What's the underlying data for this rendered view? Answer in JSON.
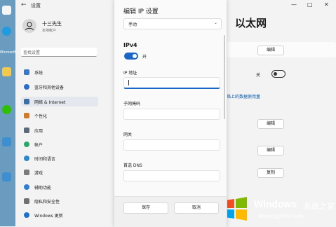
{
  "app": {
    "title": "设置"
  },
  "window_buttons": {
    "minimize": "—",
    "maximize": "□",
    "close": "✕"
  },
  "user": {
    "name": "十三先生",
    "subtitle": "本地帐户"
  },
  "search": {
    "placeholder": "查找设置"
  },
  "sidebar": {
    "items": [
      {
        "label": "系统",
        "color": "#3b78c4"
      },
      {
        "label": "蓝牙和其他设备",
        "color": "#2b6cc4"
      },
      {
        "label": "网络 & Internet",
        "color": "#3a6ea5"
      },
      {
        "label": "个性化",
        "color": "#d07b2a"
      },
      {
        "label": "应用",
        "color": "#5b6a7a"
      },
      {
        "label": "帐户",
        "color": "#2aa86a"
      },
      {
        "label": "时间和语言",
        "color": "#2c89c9"
      },
      {
        "label": "游戏",
        "color": "#7a7a7a"
      },
      {
        "label": "辅助功能",
        "color": "#2f7fd1"
      },
      {
        "label": "隐私和安全性",
        "color": "#6f6f6f"
      },
      {
        "label": "Windows 更新",
        "color": "#1f73c9"
      }
    ]
  },
  "right_pane": {
    "title": "以太网",
    "edit_label": "编辑",
    "off_label": "关",
    "link_text": "此网络上的数据使用量",
    "copy_label": "复制"
  },
  "dialog": {
    "title": "编辑 IP 设置",
    "mode_value": "手动",
    "section": "IPv4",
    "toggle_label": "开",
    "fields": {
      "ip": "IP 地址",
      "mask": "子网掩码",
      "gateway": "网关",
      "dns": "首选 DNS"
    },
    "save_label": "保存",
    "cancel_label": "取消"
  },
  "watermark": {
    "brand": "Windows",
    "tagline": "系统之家",
    "url": "www.bjjmlv.com"
  },
  "desktop": {
    "labels": [
      "Microsoft"
    ]
  },
  "colors": {
    "accent": "#1a66c8"
  }
}
